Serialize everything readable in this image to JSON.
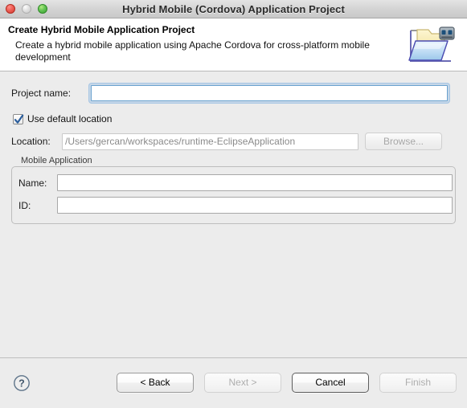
{
  "window": {
    "title": "Hybrid Mobile (Cordova) Application Project",
    "traffic_lights": [
      {
        "name": "close",
        "icon": "close-window-button",
        "state": "enabled"
      },
      {
        "name": "minimize",
        "icon": "minimize-window-button",
        "state": "disabled"
      },
      {
        "name": "zoom",
        "icon": "zoom-window-button",
        "state": "enabled"
      }
    ]
  },
  "header": {
    "title": "Create Hybrid Mobile Application Project",
    "description": "Create a hybrid mobile application using Apache Cordova for cross-platform mobile development",
    "icon": "new-mobile-project-folder-icon"
  },
  "form": {
    "project_name": {
      "label": "Project name:",
      "value": "",
      "placeholder": "",
      "focused": true
    },
    "use_default_location": {
      "label": "Use default location",
      "checked": true
    },
    "location": {
      "label": "Location:",
      "value": "/Users/gercan/workspaces/runtime-EclipseApplication",
      "enabled": false
    },
    "browse_button": {
      "label": "Browse...",
      "enabled": false
    }
  },
  "mobile_application_group": {
    "title": "Mobile Application",
    "name_field": {
      "label": "Name:",
      "value": "",
      "placeholder": ""
    },
    "id_field": {
      "label": "ID:",
      "value": "",
      "placeholder": ""
    }
  },
  "footer": {
    "help": {
      "icon": "help-question-icon",
      "label": "?"
    },
    "buttons": [
      {
        "label": "< Back",
        "name": "back-button",
        "state": "enabled"
      },
      {
        "label": "Next >",
        "name": "next-button",
        "state": "disabled"
      },
      {
        "label": "Cancel",
        "name": "cancel-button",
        "state": "emphasized"
      },
      {
        "label": "Finish",
        "name": "finish-button",
        "state": "disabled"
      }
    ]
  },
  "colors": {
    "focus_ring": "#6aa2cf",
    "window_background": "#ececec",
    "header_background": "#ffffff",
    "checkbox_check": "#2a5d9c"
  }
}
